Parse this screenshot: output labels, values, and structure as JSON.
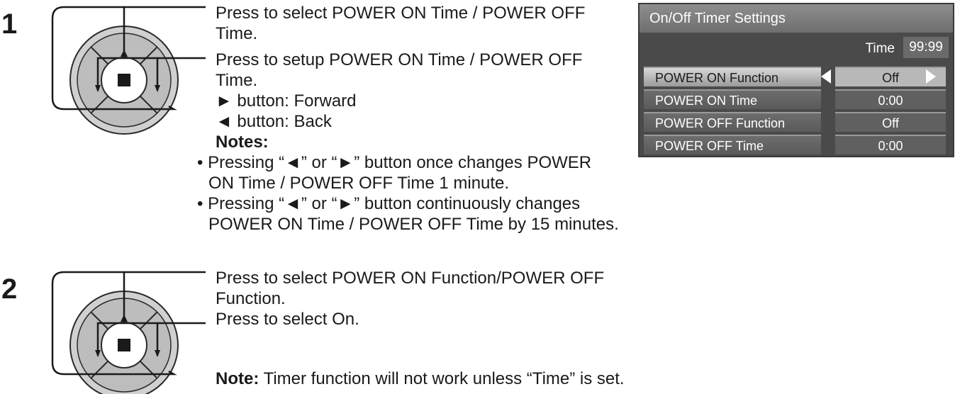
{
  "steps": [
    {
      "number": "1",
      "lines": [
        "Press to select POWER ON Time / POWER OFF",
        "Time.",
        "Press to setup POWER ON Time / POWER OFF",
        "Time.",
        "► button: Forward",
        "◄ button: Back"
      ],
      "notes_heading": "Notes:",
      "notes": [
        "• Pressing “◄” or “►” button once changes POWER",
        "ON Time / POWER OFF Time 1 minute.",
        "• Pressing “◄” or “►” button continuously changes",
        "POWER ON Time / POWER OFF Time by 15 minutes."
      ]
    },
    {
      "number": "2",
      "lines": [
        "Press to select POWER ON Function/POWER OFF",
        "Function.",
        "Press to select On."
      ],
      "note_heading": "Note:",
      "note_text": " Timer function will not work unless “Time” is set."
    }
  ],
  "osd": {
    "title": "On/Off Timer Settings",
    "time_label": "Time",
    "time_value": "99:99",
    "rows": [
      {
        "label": "POWER ON Function",
        "value": "Off",
        "active": true
      },
      {
        "label": "POWER ON Time",
        "value": "0:00",
        "active": false
      },
      {
        "label": "POWER OFF Function",
        "value": "Off",
        "active": false
      },
      {
        "label": "POWER OFF Time",
        "value": "0:00",
        "active": false
      }
    ],
    "colors": {
      "panel": "#4a4a4a",
      "title_bar": "#7e7e7e",
      "active_row": "#b8b8b8"
    }
  },
  "icons": [
    "remote-dpad-icon",
    "left-arrow-icon",
    "right-arrow-icon"
  ]
}
